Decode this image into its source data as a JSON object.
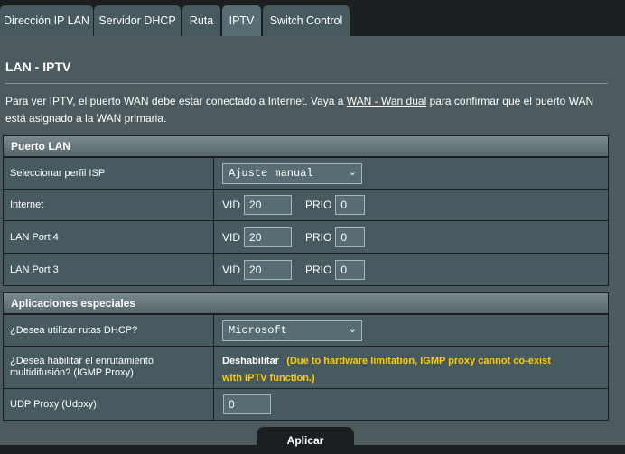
{
  "tabs": [
    "Dirección IP LAN",
    "Servidor DHCP",
    "Ruta",
    "IPTV",
    "Switch Control"
  ],
  "title": "LAN - IPTV",
  "description": {
    "before_link": "Para ver IPTV, el puerto WAN debe estar conectado a Internet. Vaya a ",
    "link": "WAN - Wan dual",
    "after_link": " para confirmar que el puerto WAN está asignado a la WAN primaria."
  },
  "lan_section": {
    "header": "Puerto LAN",
    "isp_label": "Seleccionar perfil ISP",
    "isp_value": "Ajuste manual",
    "vid_label": "VID",
    "prio_label": "PRIO",
    "rows": [
      {
        "label": "Internet",
        "vid": "20",
        "prio": "0"
      },
      {
        "label": "LAN Port 4",
        "vid": "20",
        "prio": "0"
      },
      {
        "label": "LAN Port 3",
        "vid": "20",
        "prio": "0"
      }
    ]
  },
  "special_section": {
    "header": "Aplicaciones especiales",
    "dhcp_label": "¿Desea utilizar rutas DHCP?",
    "dhcp_value": "Microsoft",
    "igmp_label": "¿Desea habilitar el enrutamiento multidifusión? (IGMP Proxy)",
    "igmp_value": "Deshabilitar",
    "igmp_note": "(Due to hardware limitation, IGMP proxy cannot co-exist with IPTV function.)",
    "udp_label": "UDP Proxy (Udpxy)",
    "udp_value": "0"
  },
  "apply_label": "Aplicar",
  "colors": {
    "panel": "#4d5a5e",
    "row": "#475a5f",
    "warning": "#ffcc00"
  }
}
